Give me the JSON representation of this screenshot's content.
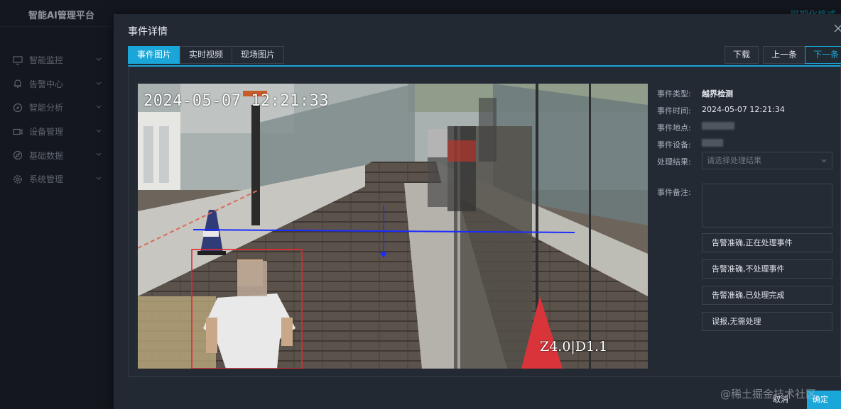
{
  "app": {
    "title": "智能AI管理平台",
    "top_link": "可视化格式"
  },
  "sidebar": {
    "items": [
      {
        "label": "智能监控",
        "icon": "monitor-icon"
      },
      {
        "label": "告警中心",
        "icon": "bell-icon"
      },
      {
        "label": "智能分析",
        "icon": "compass-icon"
      },
      {
        "label": "设备管理",
        "icon": "camera-icon"
      },
      {
        "label": "基础数据",
        "icon": "navigation-icon"
      },
      {
        "label": "系统管理",
        "icon": "gear-icon"
      }
    ]
  },
  "dialog": {
    "title": "事件详情",
    "tabs": [
      {
        "label": "事件图片",
        "active": true
      },
      {
        "label": "实时视频",
        "active": false
      },
      {
        "label": "现场图片",
        "active": false
      }
    ],
    "actions": {
      "download": "下载",
      "prev": "上一条",
      "next": "下一条"
    },
    "image": {
      "timestamp_overlay": "2024-05-07 12:21:33",
      "camera_code": "Z4.0|D1.1"
    },
    "info": {
      "event_type_label": "事件类型:",
      "event_type_value": "越界检测",
      "event_time_label": "事件时间:",
      "event_time_value": "2024-05-07 12:21:34",
      "event_location_label": "事件地点:",
      "event_device_label": "事件设备:",
      "result_label": "处理结果:",
      "result_placeholder": "请选择处理结果",
      "remark_label": "事件备注:",
      "options": [
        "告警准确,正在处理事件",
        "告警准确,不处理事件",
        "告警准确,已处理完成",
        "误报,无需处理"
      ]
    },
    "footer": {
      "cancel": "取消",
      "confirm": "确定"
    }
  },
  "watermark": "@稀土掘金技术社区",
  "colors": {
    "accent": "#1aa6d8",
    "background": "#1f242c",
    "dialog": "#232932",
    "detection_box": "#e8262c",
    "boundary_line": "#1b2cff"
  }
}
